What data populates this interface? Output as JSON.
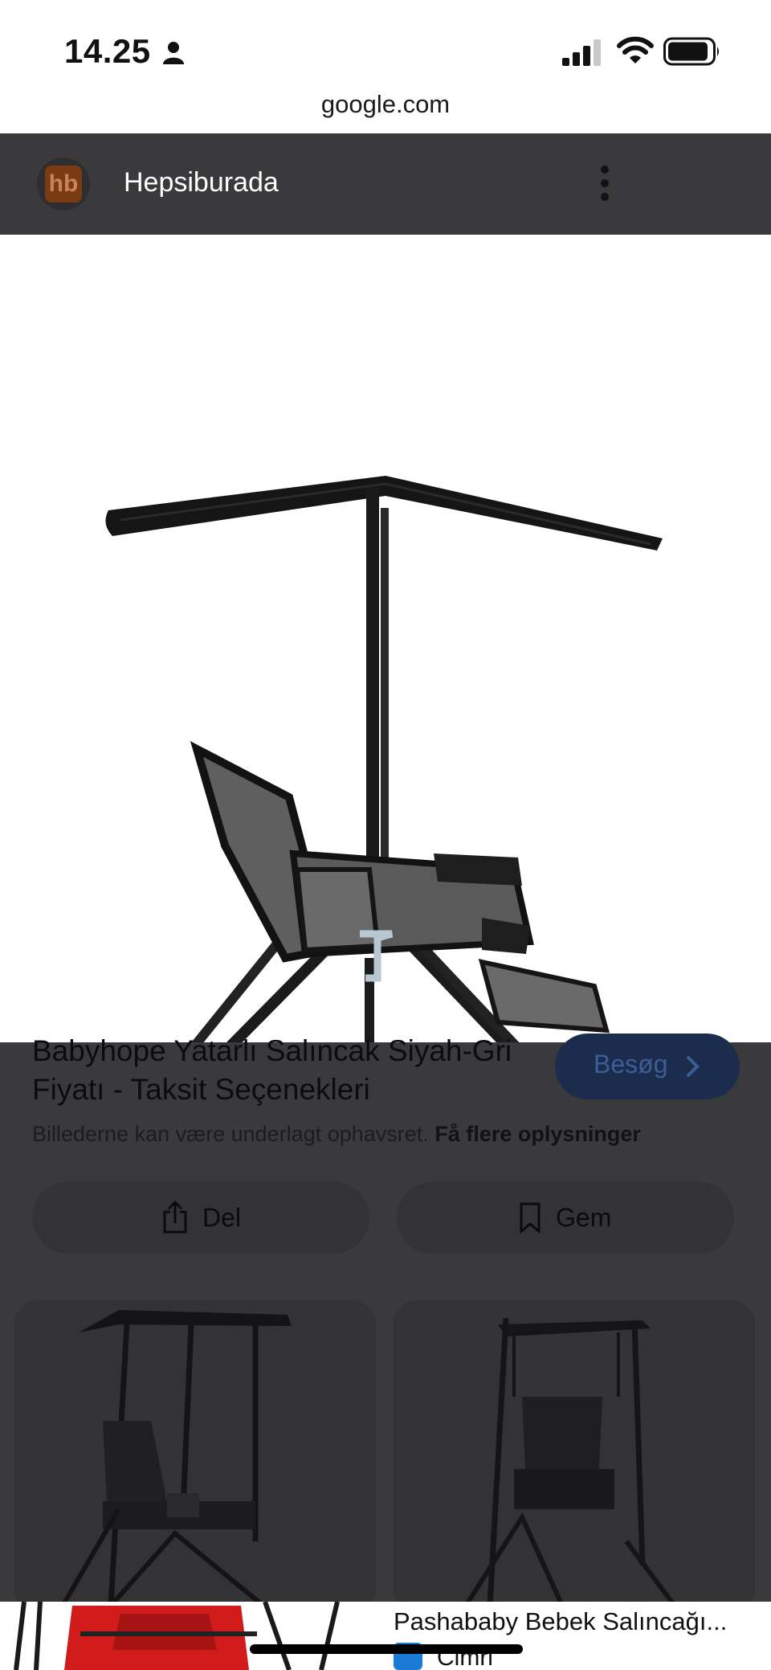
{
  "status_bar": {
    "time": "14.25",
    "icons": [
      "person-icon",
      "cellular-signal-icon",
      "wifi-icon",
      "battery-icon"
    ]
  },
  "browser": {
    "url": "google.com"
  },
  "source": {
    "logo_text": "hb",
    "name": "Hepsiburada",
    "menu_icon": "more-vertical-icon"
  },
  "result": {
    "title": "Babyhope Yatarlı Salıncak Siyah-Gri Fiyatı - Taksit Seçenekleri",
    "visit_label": "Besøg",
    "copyright_text": "Billederne kan være underlagt ophavsret.",
    "copyright_link": "Få flere oplysninger"
  },
  "actions": {
    "share_label": "Del",
    "save_label": "Gem"
  },
  "bottom_result": {
    "title": "Pashababy Bebek Salıncağı...",
    "source": "Cimri"
  },
  "colors": {
    "overlay": "#3a3a3c",
    "visit_button": "#1b2c4d",
    "brand_logo": "#7a3a12",
    "cimri_icon": "#1a7bd6"
  }
}
